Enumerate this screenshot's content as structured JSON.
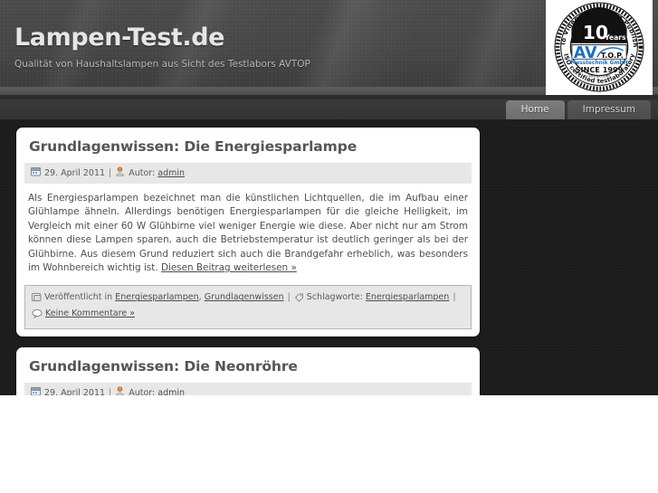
{
  "site": {
    "title": "Lampen-Test.de",
    "tagline": "Qualität von Haushaltslampen aus Sicht des Testlabors AVTOP"
  },
  "badge": {
    "icon_name": "avtop-certification-seal",
    "outer_text_top": "Audio Video Test Online Publishing",
    "outer_text_bottom": "ISO certified testlaboratory",
    "years_number": "10",
    "years_word": "Years",
    "brand": "AV",
    "top_mark": "T.O.P.",
    "company": "Messtechnik GmbH",
    "since": "SINCE 1999",
    "url": "avtop.com"
  },
  "nav": {
    "items": [
      {
        "label": "Home",
        "active": true
      },
      {
        "label": "Impressum",
        "active": false
      }
    ]
  },
  "posts": [
    {
      "title": "Grundlagenwissen: Die Energiesparlampe",
      "meta": {
        "date_icon": "calendar-icon",
        "date": "29. April 2011",
        "separator": "|",
        "author_icon": "user-icon",
        "author_label": "Autor:",
        "author_name": "admin"
      },
      "body": "Als Energiesparlampen bezeichnet man die künstlichen Lichtquellen, die im Aufbau einer Glühlampe ähneln. Allerdings benötigen Energiesparlampen für die gleiche Helligkeit, im Vergleich mit einer 60 W Glühbirne viel weniger Energie wie diese. Aber nicht nur am Strom können diese Lampen sparen, auch die Betriebstemperatur ist deutlich geringer als bei der Glühbirne. Aus diesem Grund reduziert sich auch die Brandgefahr erheblich, was besonders im Wohnbereich wichtig ist. ",
      "read_more": "Diesen Beitrag weiterlesen »",
      "footer": {
        "category_icon": "folder-icon",
        "category_label": "Veröffentlicht in",
        "categories": [
          "Energiesparlampen",
          "Grundlagenwissen"
        ],
        "separator": "|",
        "tag_icon": "tag-icon",
        "tag_label": "Schlagworte:",
        "tags": [
          "Energiesparlampen"
        ],
        "comment_icon": "comment-icon",
        "comments": "Keine Kommentare »"
      }
    },
    {
      "title": "Grundlagenwissen: Die Neonröhre",
      "meta": {
        "date_icon": "calendar-icon",
        "date": "29. April 2011",
        "separator": "|",
        "author_icon": "user-icon",
        "author_label": "Autor:",
        "author_name": "admin"
      }
    }
  ],
  "colors": {
    "page_background": "#1b1b1b",
    "header_background": "#444444",
    "card_background": "#ffffff",
    "meta_background": "#e7e7e7",
    "title_text": "#555555",
    "body_text": "#4e4e4e",
    "nav_active": "#7e7e7e",
    "author_icon": "#e8954a",
    "badge_blue": "#1c6fc4"
  }
}
